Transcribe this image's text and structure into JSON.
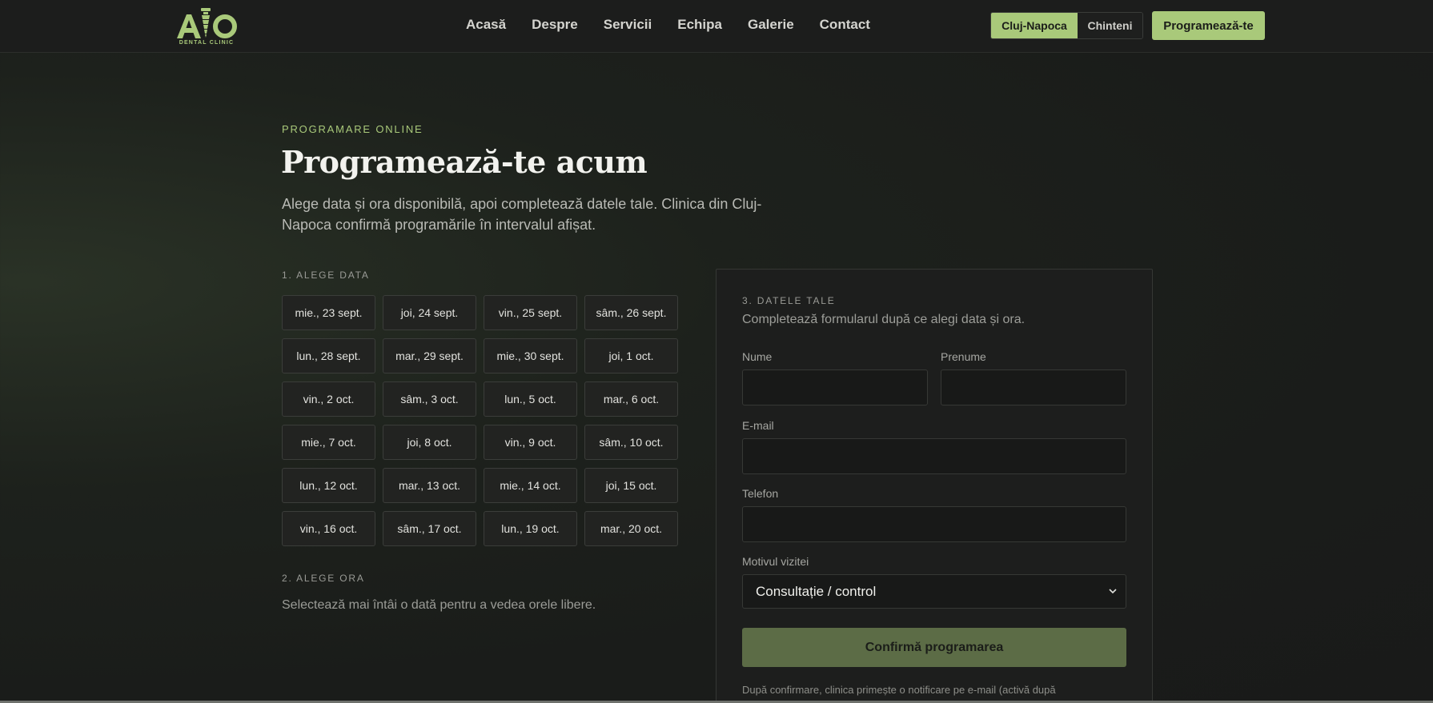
{
  "brand": {
    "logo_letters": "ATO",
    "logo_subtitle": "DENTAL CLINIC",
    "accent_color": "#a9c97a"
  },
  "nav": {
    "items": [
      "Acasă",
      "Despre",
      "Servicii",
      "Echipa",
      "Galerie",
      "Contact"
    ]
  },
  "location_toggle": {
    "options": [
      "Cluj-Napoca",
      "Chinteni"
    ],
    "selected": "Cluj-Napoca"
  },
  "header_cta": "Programează-te",
  "intro": {
    "eyebrow": "PROGRAMARE ONLINE",
    "title": "Programează-te acum",
    "lead": "Alege data și ora disponibilă, apoi completează datele tale. Clinica din Cluj-Napoca confirmă programările în intervalul afișat."
  },
  "dates_section": {
    "label": "1. ALEGE DATA",
    "dates": [
      "mie., 23 sept.",
      "joi, 24 sept.",
      "vin., 25 sept.",
      "sâm., 26 sept.",
      "lun., 28 sept.",
      "mar., 29 sept.",
      "mie., 30 sept.",
      "joi, 1 oct.",
      "vin., 2 oct.",
      "sâm., 3 oct.",
      "lun., 5 oct.",
      "mar., 6 oct.",
      "mie., 7 oct.",
      "joi, 8 oct.",
      "vin., 9 oct.",
      "sâm., 10 oct.",
      "lun., 12 oct.",
      "mar., 13 oct.",
      "mie., 14 oct.",
      "joi, 15 oct.",
      "vin., 16 oct.",
      "sâm., 17 oct.",
      "lun., 19 oct.",
      "mar., 20 oct."
    ]
  },
  "time_section": {
    "label": "2. ALEGE ORA",
    "hint": "Selectează mai întâi o dată pentru a vedea orele libere."
  },
  "form": {
    "label": "3. DATELE TALE",
    "subtitle": "Completează formularul după ce alegi data și ora.",
    "fields": {
      "nume": {
        "label": "Nume",
        "value": ""
      },
      "prenume": {
        "label": "Prenume",
        "value": ""
      },
      "email": {
        "label": "E-mail",
        "value": ""
      },
      "telefon": {
        "label": "Telefon",
        "value": ""
      }
    },
    "reason": {
      "label": "Motivul vizitei",
      "selected": "Consultație / control"
    },
    "submit_label": "Confirmă programarea",
    "note": "După confirmare, clinica primește o notificare pe e-mail (activă după"
  }
}
